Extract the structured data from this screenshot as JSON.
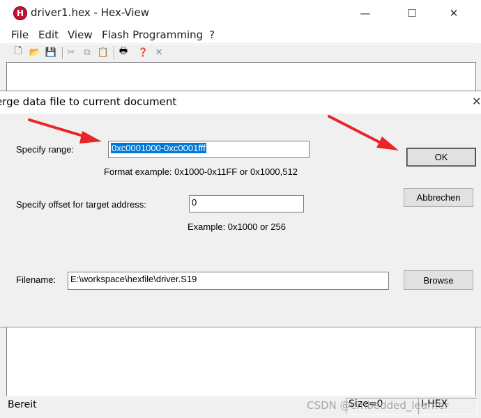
{
  "window": {
    "icon_letter": "H",
    "title": "driver1.hex - Hex-View",
    "controls": {
      "minimize": "—",
      "maximize": "☐",
      "close": "✕"
    }
  },
  "menu": [
    "File",
    "Edit",
    "View",
    "Flash Programming",
    "?"
  ],
  "toolbar": {
    "icons": [
      "new-file-icon",
      "open-folder-icon",
      "save-icon",
      "cut-icon",
      "copy-icon",
      "paste-icon",
      "print-icon",
      "help-icon",
      "delete-icon"
    ],
    "glyphs": {
      "new": "🗋",
      "open": "📂",
      "save": "💾",
      "cut": "✂",
      "copy": "⧉",
      "paste": "📋",
      "print": "🖶",
      "help": "❓",
      "delete": "✕"
    }
  },
  "dialog": {
    "title": "erge data file to current document",
    "close": "✕",
    "range_label": "Specify range:",
    "range_value": "0xc0001000-0xc0001fff",
    "range_hint": "Format example: 0x1000-0x11FF or 0x1000,512",
    "offset_label": "Specify offset for target address:",
    "offset_value": "0",
    "offset_hint": "Example:  0x1000 or 256",
    "filename_label": "Filename:",
    "filename_value": "E:\\workspace\\hexfile\\driver.S19",
    "ok": "OK",
    "cancel": "Abbrechen",
    "browse": "Browse"
  },
  "status": {
    "text": "Bereit",
    "size": "Size=0",
    "format": "I-HEX"
  },
  "watermark": "CSDN @embedded_learner",
  "colors": {
    "arrow": "#e8262a",
    "selection": "#0078d7",
    "brand_icon": "#c8102e"
  }
}
